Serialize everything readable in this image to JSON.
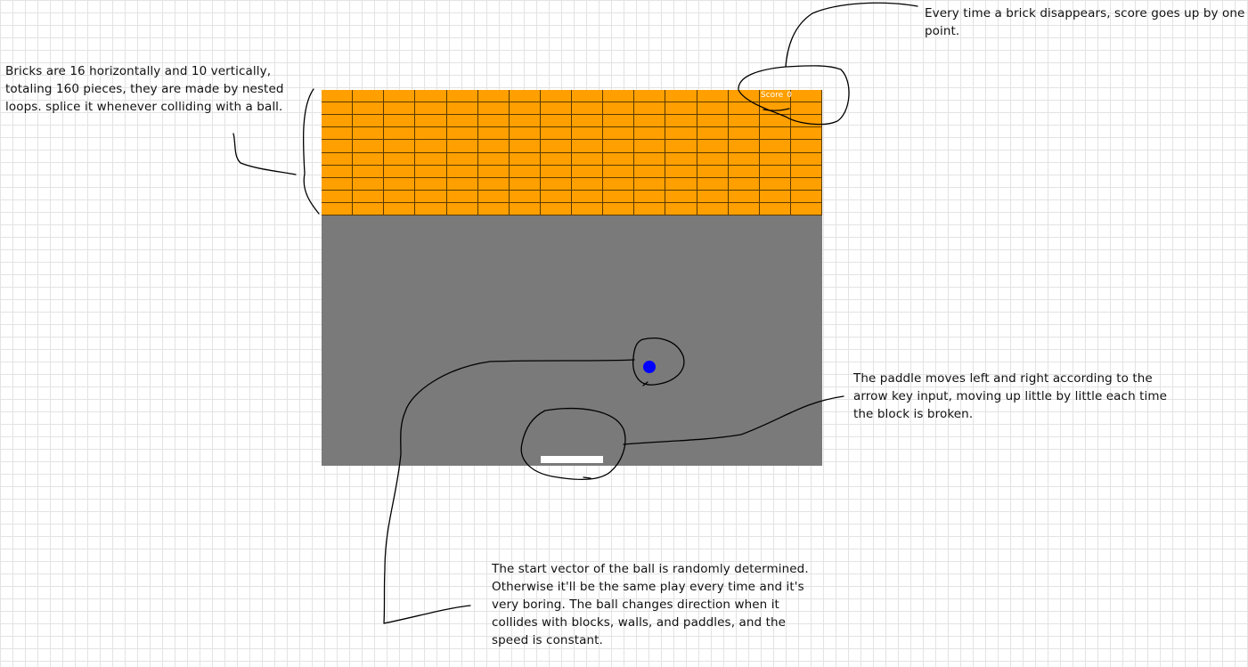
{
  "notes": {
    "bricks": "Bricks are 16 horizontally and 10 vertically, totaling 160 pieces, they are made by nested loops. splice it whenever colliding with a ball.",
    "score": "Every time a brick disappears, score goes up by one point.",
    "paddle": "The paddle moves left and right according to the arrow key input, moving up little by little each time the block is broken.",
    "ball": "The start vector of the ball is randomly determined. Otherwise it'll be the same play every time and it's very boring. The ball changes direction when it collides with blocks, walls, and paddles, and the speed is constant."
  },
  "game": {
    "score_label": "Score",
    "score_value": "0",
    "bricks": {
      "columns": 16,
      "rows": 10
    },
    "colors": {
      "background": "#7a7a7a",
      "brick": "#ff9f00",
      "brick_border": "#5a3a00",
      "ball": "#0000ff",
      "paddle": "#ffffff",
      "score_text": "#ffffff"
    }
  }
}
